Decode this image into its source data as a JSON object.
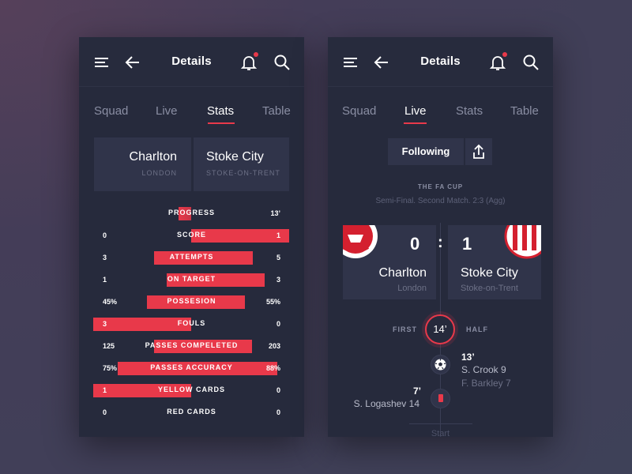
{
  "colors": {
    "accent": "#e8394a",
    "panel": "#262a3c",
    "card": "#30344a"
  },
  "left": {
    "title": "Details",
    "tabs": [
      "Squad",
      "Live",
      "Stats",
      "Table"
    ],
    "active_tab": "Stats",
    "home": {
      "name": "Charlton",
      "city": "LONDON"
    },
    "away": {
      "name": "Stoke City",
      "city": "STOKE-ON-TRENT"
    },
    "stats": [
      {
        "label": "PROGRESS",
        "left": "",
        "right": "13’",
        "left_frac": 0.13,
        "right_frac": 0
      },
      {
        "label": "SCORE",
        "left": "0",
        "right": "1",
        "left_frac": 0,
        "right_frac": 1.0
      },
      {
        "label": "ATTEMPTS",
        "left": "3",
        "right": "5",
        "left_frac": 0.375,
        "right_frac": 0.625
      },
      {
        "label": "ON TARGET",
        "left": "1",
        "right": "3",
        "left_frac": 0.25,
        "right_frac": 0.75
      },
      {
        "label": "POSSESION",
        "left": "45%",
        "right": "55%",
        "left_frac": 0.45,
        "right_frac": 0.55
      },
      {
        "label": "FOULS",
        "left": "3",
        "right": "0",
        "left_frac": 1.0,
        "right_frac": 0
      },
      {
        "label": "PASSES COMPELETED",
        "left": "125",
        "right": "203",
        "left_frac": 0.38,
        "right_frac": 0.62
      },
      {
        "label": "PASSES ACCURACY",
        "left": "75%",
        "right": "88%",
        "left_frac": 0.75,
        "right_frac": 0.88
      },
      {
        "label": "YELLOW CARDS",
        "left": "1",
        "right": "0",
        "left_frac": 1.0,
        "right_frac": 0
      },
      {
        "label": "RED CARDS",
        "left": "0",
        "right": "0",
        "left_frac": 0,
        "right_frac": 0
      }
    ]
  },
  "right": {
    "title": "Details",
    "tabs": [
      "Squad",
      "Live",
      "Stats",
      "Table"
    ],
    "active_tab": "Live",
    "follow_label": "Following",
    "competition": "THE FA CUP",
    "competition_sub": "Semi-Final. Second Match. 2:3 (Agg)",
    "home": {
      "name": "Charlton",
      "city": "London",
      "score": "0"
    },
    "away": {
      "name": "Stoke City",
      "city": "Stoke-on-Trent",
      "score": "1"
    },
    "separator": ":",
    "half_first": "FIRST",
    "half_second": "HALF",
    "current_minute": "14’",
    "events": [
      {
        "minute": "13’",
        "main": "S. Crook 9",
        "sub": "F. Barkley 7",
        "side": "right",
        "icon": "football-icon"
      },
      {
        "minute": "7’",
        "main": "S. Logashev 14",
        "side": "left",
        "icon": "red-card-icon"
      }
    ],
    "start_label": "Start"
  }
}
